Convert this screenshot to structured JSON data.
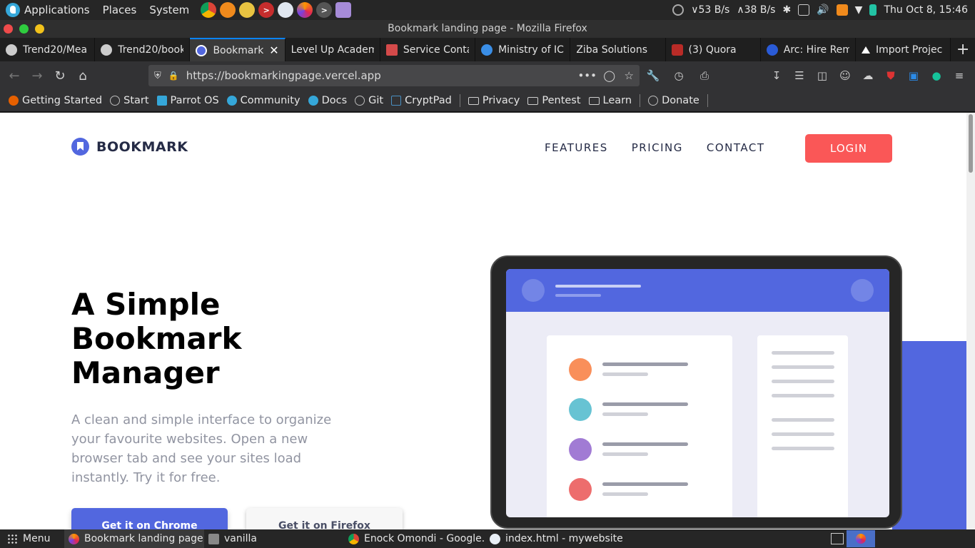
{
  "system_panel": {
    "menus": [
      "Applications",
      "Places",
      "System"
    ],
    "launcher_icons": [
      "chrome-icon",
      "vlc-icon",
      "keyring-icon",
      "terminal-red-icon",
      "network-icon",
      "firefox-icon",
      "terminal-icon",
      "text-editor-icon"
    ],
    "net_down": "53 B/s",
    "net_up": "38 B/s",
    "clock": "Thu Oct  8, 15:46"
  },
  "window": {
    "title": "Bookmark landing page - Mozilla Firefox"
  },
  "tabs": [
    {
      "label": "Trend20/Mea",
      "color": "#cccccc",
      "active": false
    },
    {
      "label": "Trend20/book",
      "color": "#cccccc",
      "active": false
    },
    {
      "label": "Bookmark l",
      "color": "#5267df",
      "active": true
    },
    {
      "label": "Level Up Academ",
      "color": "#000000",
      "active": false
    },
    {
      "label": "Service Conta",
      "color": "#d44a4a",
      "active": false
    },
    {
      "label": "Ministry of IC",
      "color": "#3a8ee6",
      "active": false
    },
    {
      "label": "Ziba Solutions",
      "color": "#1f1f1f",
      "active": false
    },
    {
      "label": "(3) Quora",
      "color": "#b92b27",
      "active": false
    },
    {
      "label": "Arc: Hire Rem",
      "color": "#2a5bd7",
      "active": false
    },
    {
      "label": "Import Projec",
      "color": "#ffffff",
      "active": false
    }
  ],
  "address_bar": {
    "url": "https://bookmarkingpage.vercel.app"
  },
  "bookmarks": [
    {
      "label": "Getting Started",
      "kind": "site",
      "color": "#e66000"
    },
    {
      "label": "Start",
      "kind": "site",
      "color": "#bbbbbb"
    },
    {
      "label": "Parrot OS",
      "kind": "site",
      "color": "#35a7d9"
    },
    {
      "label": "Community",
      "kind": "site",
      "color": "#35a7d9"
    },
    {
      "label": "Docs",
      "kind": "site",
      "color": "#35a7d9"
    },
    {
      "label": "Git",
      "kind": "site",
      "color": "#bbbbbb"
    },
    {
      "label": "CryptPad",
      "kind": "site",
      "color": "#4a90c2"
    },
    {
      "label": "Privacy",
      "kind": "folder"
    },
    {
      "label": "Pentest",
      "kind": "folder"
    },
    {
      "label": "Learn",
      "kind": "folder"
    },
    {
      "label": "Donate",
      "kind": "site",
      "color": "#bbbbbb"
    }
  ],
  "site": {
    "brand": "BOOKMARK",
    "nav": [
      "FEATURES",
      "PRICING",
      "CONTACT"
    ],
    "login": "LOGIN",
    "hero_title": "A Simple Bookmark Manager",
    "hero_subtitle": "A clean and simple interface to organize your favourite websites. Open a new browser tab and see your sites load instantly. Try it for free.",
    "cta_chrome": "Get it on Chrome",
    "cta_firefox": "Get it on Firefox",
    "colors": {
      "primary_blue": "#5267df",
      "soft_red": "#fa5757",
      "dark_blue": "#252b46",
      "grayish_blue": "#9194a1"
    },
    "illustration_dots": [
      "#f98f5a",
      "#67c3d3",
      "#a17bd4",
      "#ed6d6d"
    ]
  },
  "taskbar": {
    "menu": "Menu",
    "items": [
      {
        "label": "Bookmark landing page ...",
        "icon": "firefox-icon",
        "active": true
      },
      {
        "label": "vanilla",
        "icon": "folder-icon",
        "active": false
      },
      {
        "label": "Enock Omondi - Google...",
        "icon": "chrome-icon",
        "active": false
      },
      {
        "label": "index.html - mywebsite ...",
        "icon": "vscode-icon",
        "active": false
      }
    ]
  }
}
